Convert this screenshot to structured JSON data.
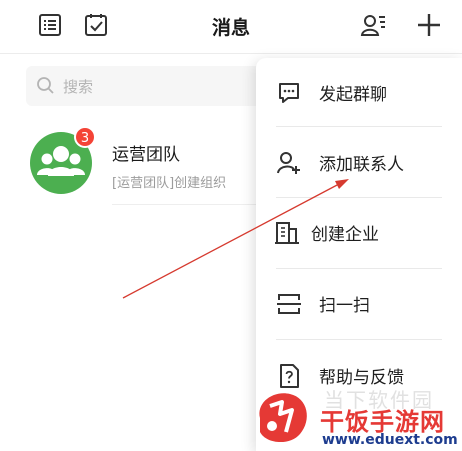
{
  "header": {
    "title": "消息",
    "left_icons": [
      "list-icon",
      "task-check-icon"
    ],
    "right_icons": [
      "contacts-icon",
      "plus-icon"
    ]
  },
  "search": {
    "placeholder": "搜索"
  },
  "chats": [
    {
      "name": "运营团队",
      "preview": "[运营团队]创建组织",
      "unread": "3",
      "avatar_color": "#4caf50"
    }
  ],
  "menu": {
    "items": [
      {
        "label": "发起群聊",
        "icon": "group-chat-icon"
      },
      {
        "label": "添加联系人",
        "icon": "add-contact-icon"
      },
      {
        "label": "创建企业",
        "icon": "building-icon"
      },
      {
        "label": "扫一扫",
        "icon": "scan-icon"
      },
      {
        "label": "帮助与反馈",
        "icon": "help-doc-icon"
      }
    ]
  },
  "watermark": {
    "faded": "当下软件园",
    "brand": "干饭手游网",
    "url": "www.eduext.com"
  },
  "colors": {
    "accent_green": "#4caf50",
    "badge_red": "#f44336",
    "arrow_red": "#d63a2f",
    "brand_red": "#e53935",
    "url_blue": "#1d3c8f"
  }
}
